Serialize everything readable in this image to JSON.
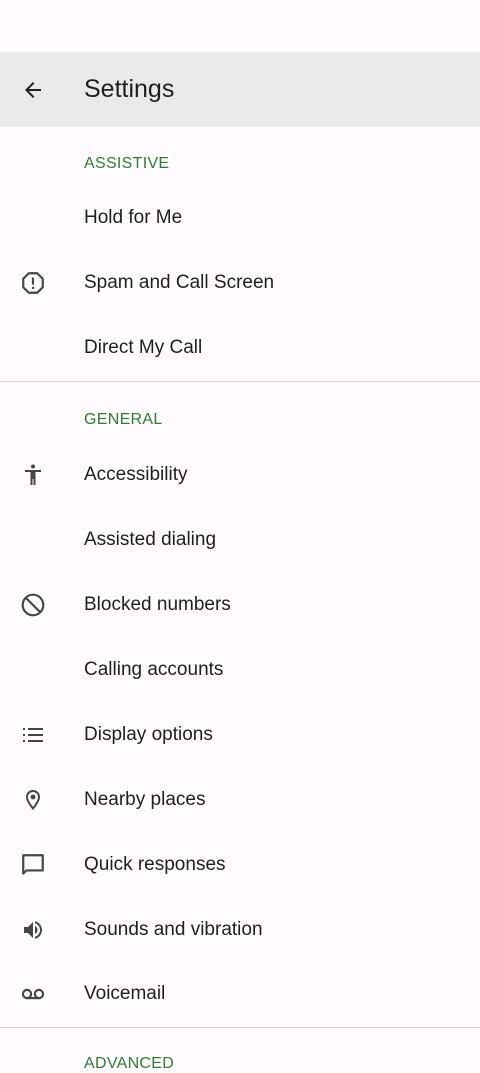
{
  "header": {
    "title": "Settings",
    "back_icon": "arrow-back-icon"
  },
  "sections": {
    "assistive": {
      "title": "ASSISTIVE",
      "items": [
        {
          "label": "Hold for Me",
          "icon": ""
        },
        {
          "label": "Spam and Call Screen",
          "icon": "report-icon"
        },
        {
          "label": "Direct My Call",
          "icon": ""
        }
      ]
    },
    "general": {
      "title": "GENERAL",
      "items": [
        {
          "label": "Accessibility",
          "icon": "accessibility-icon"
        },
        {
          "label": "Assisted dialing",
          "icon": ""
        },
        {
          "label": "Blocked numbers",
          "icon": "block-icon"
        },
        {
          "label": "Calling accounts",
          "icon": ""
        },
        {
          "label": "Display options",
          "icon": "list-icon"
        },
        {
          "label": "Nearby places",
          "icon": "location-pin-icon"
        },
        {
          "label": "Quick responses",
          "icon": "chat-bubble-icon"
        },
        {
          "label": "Sounds and vibration",
          "icon": "volume-icon"
        },
        {
          "label": "Voicemail",
          "icon": "voicemail-icon"
        }
      ]
    },
    "advanced": {
      "title": "ADVANCED"
    }
  },
  "colors": {
    "accent": "#2e7d32",
    "app_bar": "#e9ebea",
    "background": "#fffbfe",
    "icon": "#444746"
  }
}
